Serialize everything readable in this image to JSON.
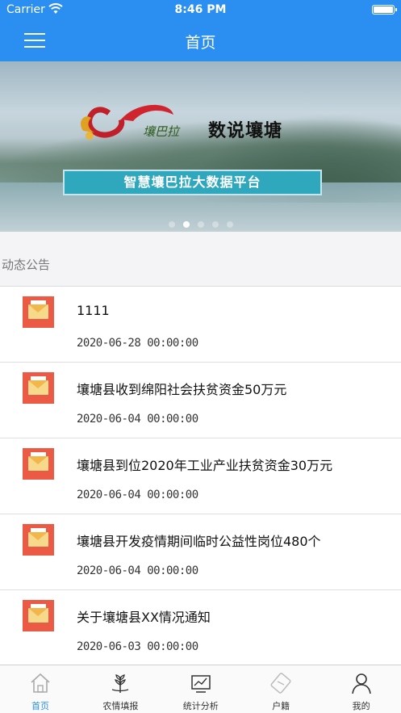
{
  "status_bar": {
    "carrier": "Carrier",
    "time": "8:46 PM"
  },
  "nav": {
    "title": "首页"
  },
  "banner": {
    "title": "数说壤塘",
    "subtitle": "智慧壤巴拉大数据平台",
    "logo_text": "壤巴拉",
    "page_count": 5,
    "active_page": 2
  },
  "notices": {
    "heading": "动态公告",
    "items": [
      {
        "title": "1111",
        "date": "2020-06-28 00:00:00"
      },
      {
        "title": "壤塘县收到绵阳社会扶贫资金50万元",
        "date": "2020-06-04 00:00:00"
      },
      {
        "title": "壤塘县到位2020年工业产业扶贫资金30万元",
        "date": "2020-06-04 00:00:00"
      },
      {
        "title": "壤塘县开发疫情期间临时公益性岗位480个",
        "date": "2020-06-04 00:00:00"
      },
      {
        "title": "关于壤塘县XX情况通知",
        "date": "2020-06-03 00:00:00"
      }
    ]
  },
  "tabs": [
    {
      "label": "首页",
      "icon": "home-icon",
      "active": true
    },
    {
      "label": "农情填报",
      "icon": "wheat-icon",
      "active": false
    },
    {
      "label": "统计分析",
      "icon": "chart-icon",
      "active": false
    },
    {
      "label": "户籍",
      "icon": "id-card-icon",
      "active": false
    },
    {
      "label": "我的",
      "icon": "user-icon",
      "active": false
    }
  ],
  "colors": {
    "primary": "#2a8ff0",
    "notice_icon": "#ea5a44",
    "banner_plate": "#2fa7bd"
  }
}
